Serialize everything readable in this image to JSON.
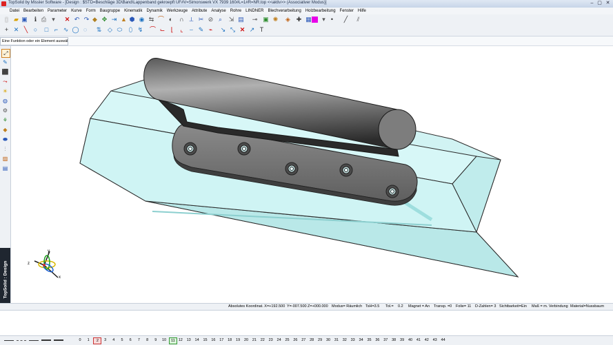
{
  "window": {
    "title": "TopSolid by Missler Software - [Design : $STD=Beschläge 3D\\Band\\Lappenband gekroepft UF#V=Simonswerk VX 7939 160#L=1#R=NR.top  <<aktiv>> (Associativer Modus)]",
    "controls": [
      "–",
      "▢",
      "✕"
    ]
  },
  "menu": [
    "Datei",
    "Bearbeiten",
    "Parameter",
    "Kurve",
    "Form",
    "Baugruppe",
    "Kinematik",
    "Dynamik",
    "Werkzeuge",
    "Attribute",
    "Analyse",
    "Rohre",
    "LINDNER",
    "Blechverarbeitung",
    "Holzbearbeitung",
    "Fenster",
    "Hilfe"
  ],
  "hint": {
    "text": "Eine Funktion oder ein Element auswählen"
  },
  "brand": {
    "text": "TopSolid : Design"
  },
  "triad": {
    "x": "x",
    "y": "y",
    "z": "z"
  },
  "status": {
    "coord": "Absolutes Koordinat. X=+192.500",
    "y": "Y=-007.500",
    "z": "Z=+000.000",
    "modus": "Modus= Räumlich",
    "tsh": "TsH=3.5",
    "tol": "Tol.=",
    "tolval": "0.2",
    "magnet": "Magnet = An",
    "transp": "Transp. =0",
    "folie": "Folie= 11",
    "dzahlen": "D-Zahlen= 3",
    "sicht": "Sichtbarkeit=Ein",
    "mass": "Maß = m. Verbindung",
    "material": "Material=Nussbaum"
  },
  "layers": [
    "0",
    "1",
    "2",
    "3",
    "4",
    "5",
    "6",
    "7",
    "8",
    "9",
    "10",
    "11",
    "12",
    "13",
    "14",
    "15",
    "16",
    "17",
    "18",
    "19",
    "20",
    "21",
    "22",
    "23",
    "24",
    "25",
    "26",
    "27",
    "28",
    "29",
    "30",
    "31",
    "32",
    "33",
    "34",
    "35",
    "36",
    "37",
    "38",
    "39",
    "40",
    "41",
    "42",
    "43",
    "44"
  ],
  "layer_selected": "2",
  "layer_current": "11",
  "colors": {
    "accent_magenta": "#e800e8",
    "glass": "#c9f1f1",
    "metal": "#6b6b6b"
  }
}
